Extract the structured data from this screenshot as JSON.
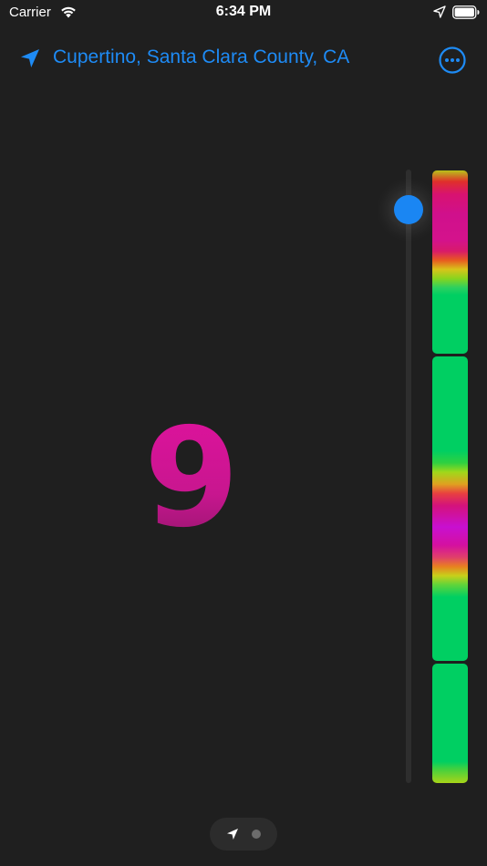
{
  "status_bar": {
    "carrier": "Carrier",
    "time": "6:34 PM",
    "icons": [
      "wifi-icon",
      "location-arrow-icon",
      "battery-icon"
    ]
  },
  "header": {
    "location_title": "Cupertino, Santa Clara County, CA",
    "location_icon": "location-arrow-icon",
    "more_icon": "ellipsis-circle-icon",
    "accent_color": "#1e8bf5"
  },
  "main": {
    "value": "9",
    "value_color": "#d31a9b"
  },
  "slider": {
    "thumb_color": "#1a86f3"
  },
  "forecast_bar": {
    "segments": 3,
    "colors": {
      "low": "#00cf62",
      "high": "#d0108c",
      "extreme": "#c810d0"
    }
  },
  "page_indicator": {
    "pages": [
      "location-arrow-icon",
      "dot"
    ],
    "current_page": 1
  }
}
